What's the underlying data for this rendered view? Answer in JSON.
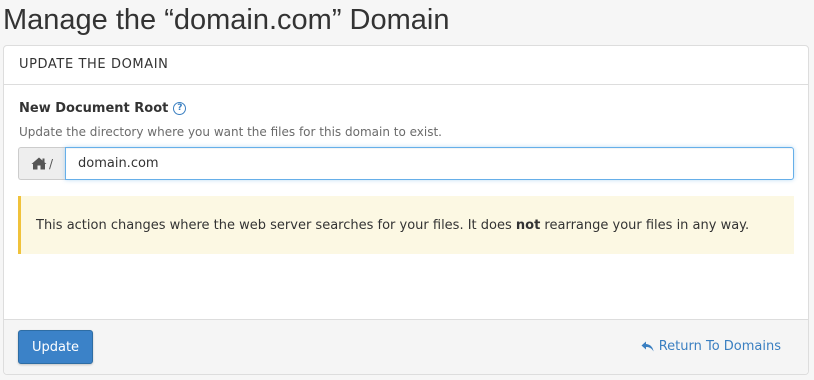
{
  "page": {
    "title": "Manage the “domain.com” Domain"
  },
  "panel": {
    "heading": "UPDATE THE DOMAIN",
    "field": {
      "label": "New Document Root",
      "help_icon": "question-circle-icon",
      "help_text": "Update the directory where you want the files for this domain to exist.",
      "prefix_icon": "home-icon",
      "prefix_text": "/",
      "value": "domain.com"
    },
    "alert": {
      "text_before": "This action changes where the web server searches for your files. It does ",
      "text_bold": "not",
      "text_after": " rearrange your files in any way."
    }
  },
  "footer": {
    "update_label": "Update",
    "return_icon": "reply-arrow-icon",
    "return_label": "Return To Domains"
  },
  "colors": {
    "accent": "#3b82c8",
    "link": "#3a7fc1",
    "alert_bg": "#fcf8e3",
    "alert_border": "#f0c23b"
  }
}
